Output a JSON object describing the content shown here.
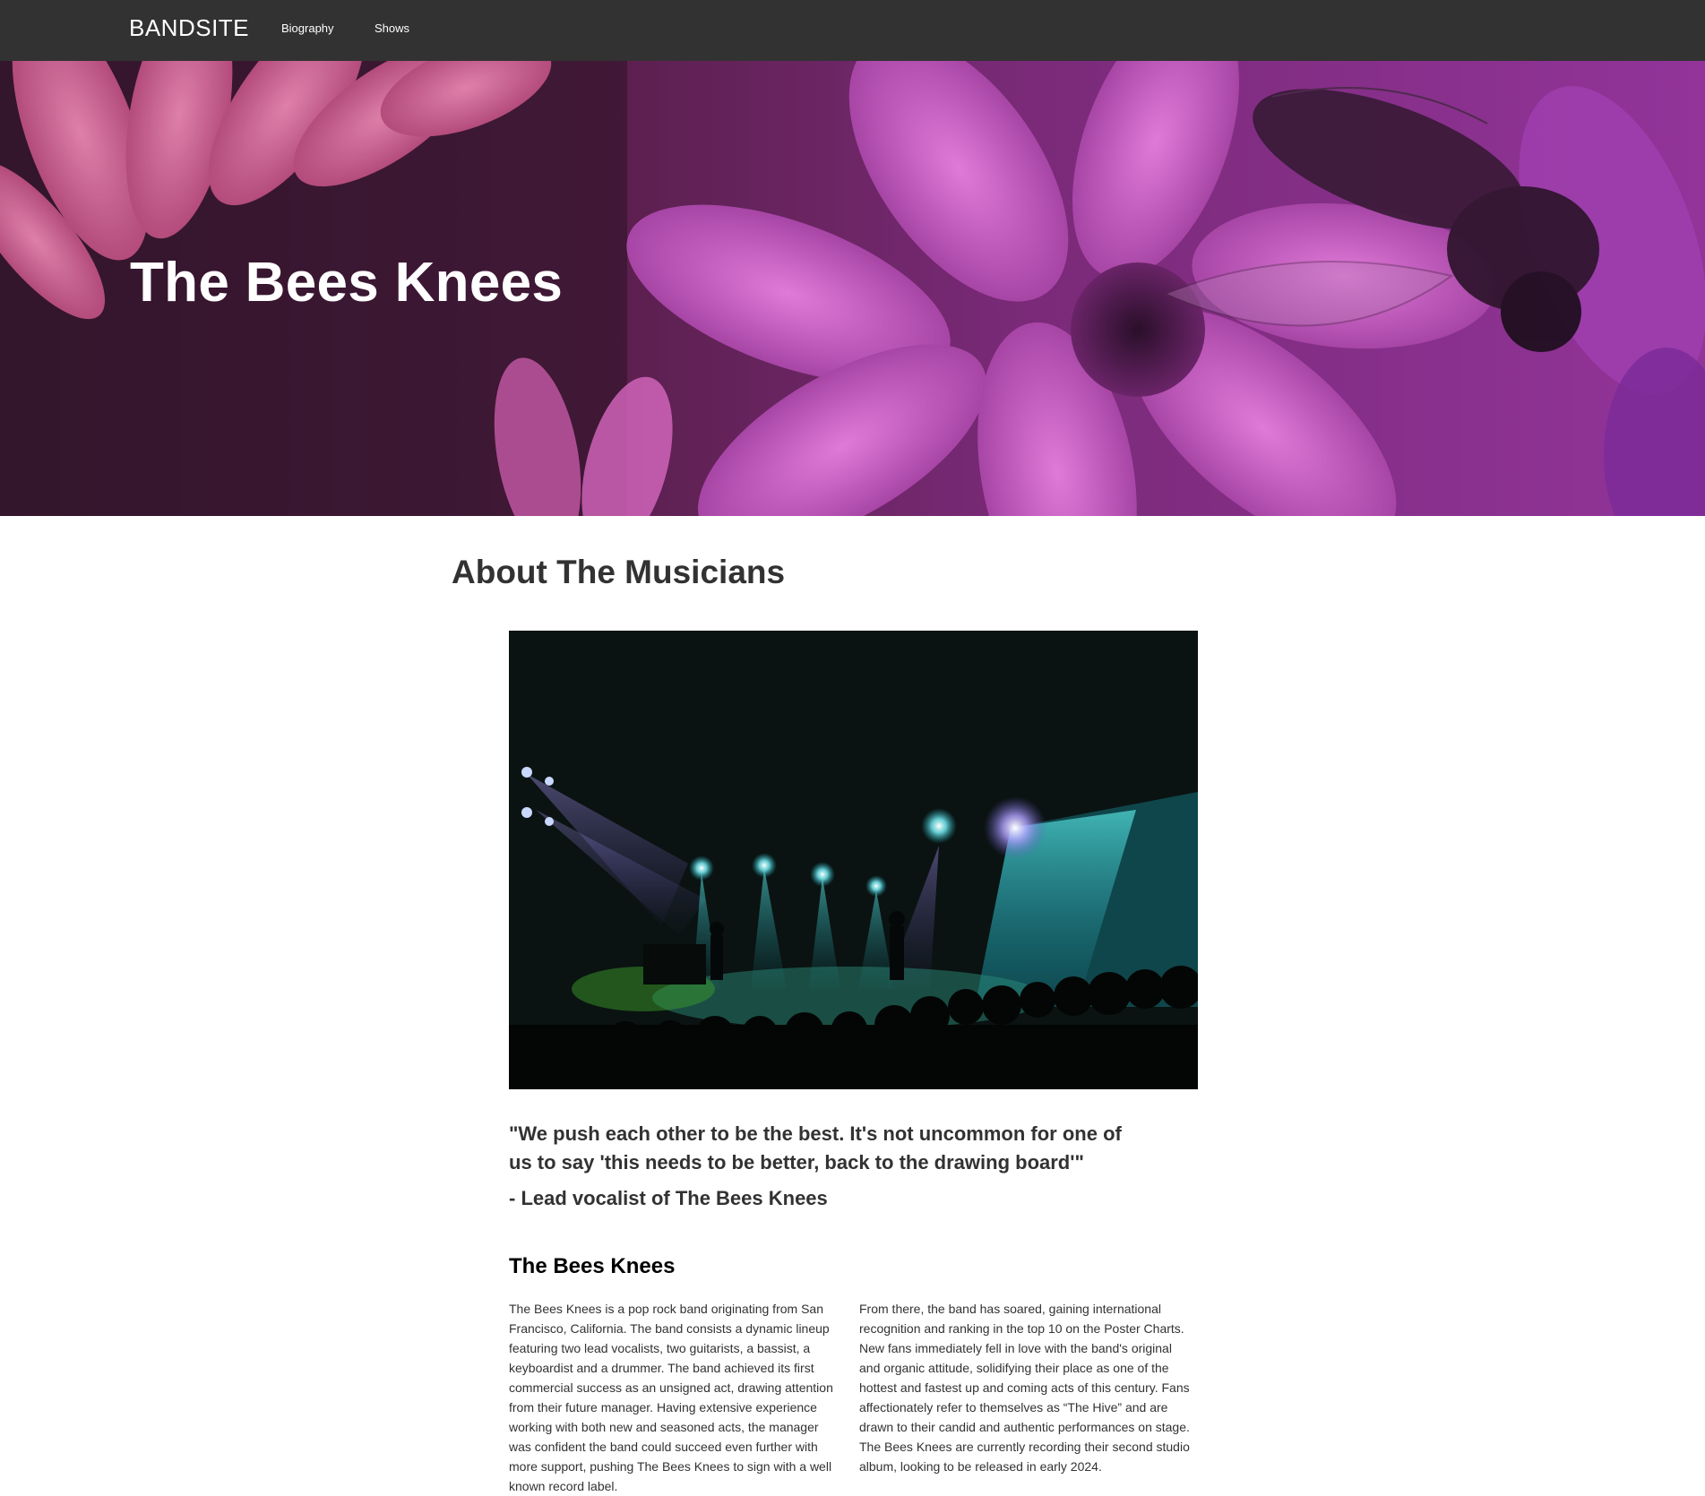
{
  "nav": {
    "brand": "BANDSITE",
    "links": [
      "Biography",
      "Shows"
    ]
  },
  "hero": {
    "title": "The Bees Knees"
  },
  "about": {
    "heading": "About The Musicians",
    "quote": "\"We push each other to be the best. It's not uncommon for one of us to say 'this needs to be better, back to the drawing board'\"",
    "quote_author": "- Lead vocalist of The Bees Knees",
    "band_heading": "The Bees Knees",
    "paragraph_left": "The Bees Knees is a pop rock band originating from San Francisco, California. The band consists a dynamic lineup featuring two lead vocalists, two guitarists, a bassist, a keyboardist and a drummer. The band achieved its first commercial success as an unsigned act, drawing attention from their future manager. Having extensive experience working with both new and seasoned acts, the manager was confident the band could succeed even further with more support, pushing The Bees Knees to sign with a well known record label.",
    "paragraph_right": "From there, the band has soared, gaining international recognition and ranking in the top 10 on the Poster Charts. New fans immediately fell in love with the band's original and organic attitude, solidifying their place as one of the hottest and fastest up and coming acts of this century. Fans affectionately refer to themselves as “The Hive” and are drawn to their candid and authentic performances on stage. The Bees Knees are currently recording their second studio album, looking to be released in early 2024."
  },
  "colors": {
    "nav_bg": "#323232",
    "text": "#323232",
    "hero_tint": "#92349a"
  }
}
